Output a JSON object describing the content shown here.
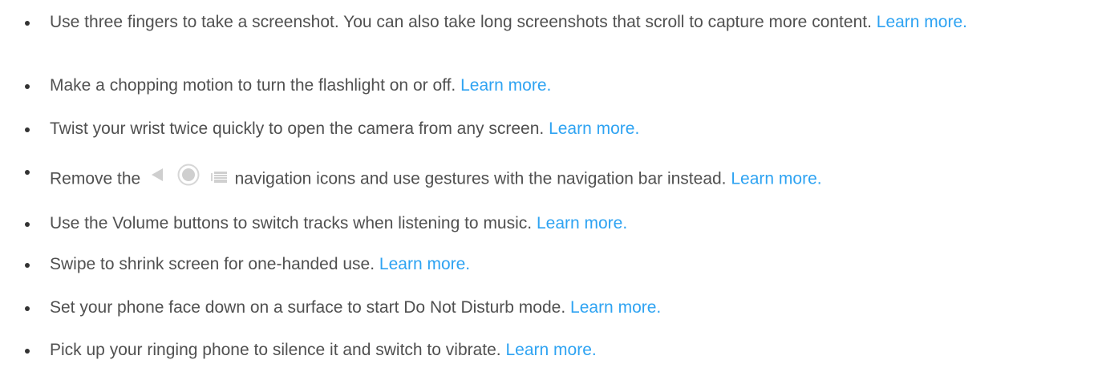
{
  "items": [
    {
      "text": "Use three fingers to take a screenshot. You can also take long screenshots that scroll to capture more content.",
      "link": "Learn more."
    },
    {
      "text": "Make a chopping motion to turn the flashlight on or off.",
      "link": "Learn more."
    },
    {
      "text": "Twist your wrist twice quickly to open the camera from any screen.",
      "link": "Learn more."
    },
    {
      "text_before": "Remove the",
      "icons": [
        "back-triangle-icon",
        "home-circle-icon",
        "recents-icon"
      ],
      "text_after": "navigation icons and use gestures with the navigation bar instead.",
      "link": "Learn more."
    },
    {
      "text": "Use the Volume buttons to switch tracks when listening to music.",
      "link": "Learn more."
    },
    {
      "text": "Swipe to shrink screen for one-handed use.",
      "link": "Learn more."
    },
    {
      "text": "Set your phone face down on a surface to start Do Not Disturb mode.",
      "link": "Learn more."
    },
    {
      "text": "Pick up your ringing phone to silence it and switch to vibrate.",
      "link": "Learn more."
    }
  ],
  "colors": {
    "text": "#505050",
    "link": "#2ea3f2",
    "icon": "#cfcfcf"
  }
}
